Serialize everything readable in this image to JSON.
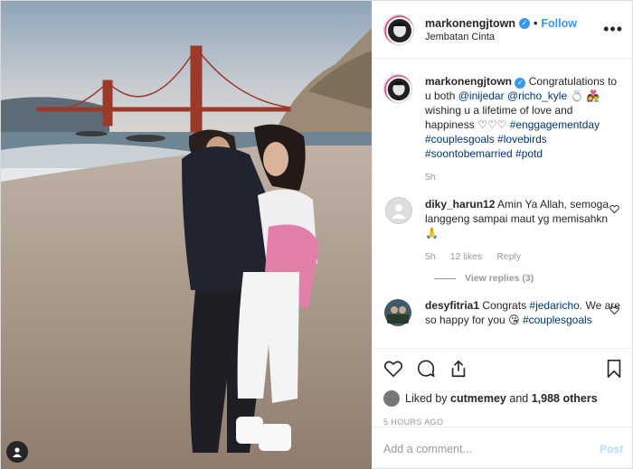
{
  "header": {
    "username": "markonengjtown",
    "separator": "•",
    "follow_label": "Follow",
    "location": "Jembatan Cinta",
    "more_label": "•••"
  },
  "caption": {
    "username": "markonengjtown",
    "text_1": "Congratulations to u both",
    "mention_1": "@inijedar",
    "mention_2": "@richo_kyle",
    "emoji_ring": "💍",
    "emoji_couple": "👩‍❤️‍👨",
    "text_2": "wishing u a lifetime of love and happiness",
    "emoji_hearts": "♡♡♡",
    "tags": "#enggagementday #couplesgoals #lovebirds #soontobemarried #potd",
    "time": "5h"
  },
  "comments": [
    {
      "username": "diky_harun12",
      "text": "Amin Ya Allah, semoga langgeng sampai maut yg memisahkn",
      "emoji": "🙏",
      "time": "5h",
      "likes": "12 likes",
      "reply": "Reply",
      "view_replies": "View replies (3)"
    },
    {
      "username": "desyfitria1",
      "text_1": "Congrats",
      "tag": "#jedaricho",
      "text_2": ". We are so happy for you",
      "emoji": "😘",
      "tail": "#couplesgoals"
    }
  ],
  "likes": {
    "prefix": "Liked by",
    "user": "cutmemey",
    "middle": "and",
    "count": "1,988 others"
  },
  "timestamp": "5 HOURS AGO",
  "add_comment": {
    "placeholder": "Add a comment...",
    "post_label": "Post"
  },
  "colors": {
    "link_blue": "#3897f0",
    "hashtag": "#003569",
    "muted": "#999999"
  }
}
